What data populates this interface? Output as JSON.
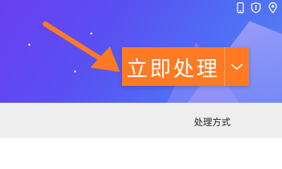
{
  "primary_action": {
    "label": "立即处理"
  },
  "dropdown": {
    "icon": "chevron-down-icon"
  },
  "top_icons": [
    "phone-icon",
    "shield-icon",
    "pin-icon"
  ],
  "section": {
    "label": "处理方式"
  },
  "colors": {
    "accent": "#ff7a22",
    "hero_start": "#6a3ff0",
    "hero_end": "#5b82f3",
    "bar_background": "#eeeeee"
  }
}
